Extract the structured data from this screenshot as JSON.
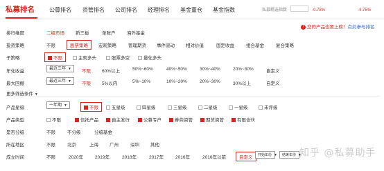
{
  "nav": {
    "brand": "私募排名",
    "tabs": [
      "公募排名",
      "资管排名",
      "公司排名",
      "经理排名",
      "基金重仓",
      "基金指数"
    ],
    "ticker_label": "私募精选指数",
    "ticker_values": [
      "-0.78%",
      "-4.75%"
    ]
  },
  "hint": {
    "dot": "!",
    "text": "您的产品也要上榜！",
    "link": "点此参与排名"
  },
  "rows": {
    "sort_dim": {
      "label": "排行维度",
      "options": [
        "二级市场",
        "新三板",
        "单账户",
        "海外基金"
      ]
    },
    "strategy": {
      "label": "投资策略",
      "options": [
        "不限",
        "股票策略",
        "宏观策略",
        "管理期货",
        "事件驱动",
        "相对价值",
        "固定收益",
        "组合基金",
        "复合策略"
      ]
    },
    "sub": {
      "label": "子策略",
      "options": [
        "不限",
        "主观多头",
        "股票多空",
        "量化多头"
      ]
    },
    "annual": {
      "label": "年化收益",
      "select": "最近三年",
      "options": [
        "不限",
        "60%以上",
        "50%~60%",
        "40%~50%",
        "30%~40%",
        "20%~30%",
        "自定义"
      ]
    },
    "drawdown": {
      "label": "最大回撤",
      "select": "最近三年",
      "options": [
        "不限",
        "5%以内",
        "5%~10%",
        "10%~20%",
        "20%~30%",
        "30%以上",
        "自定义"
      ]
    },
    "more": {
      "label": "更多筛选条件"
    },
    "star": {
      "label": "产品星级",
      "select": "一年期",
      "options": [
        "不限",
        "五星级",
        "四星级",
        "三星级",
        "二星级",
        "一星级",
        "未评级"
      ]
    },
    "type": {
      "label": "产品类型",
      "options": [
        "不限",
        "信托产品",
        "自主发行",
        "公募专户",
        "券商资管",
        "期货资管",
        "有限合伙"
      ]
    },
    "grade": {
      "label": "是否分级",
      "options": [
        "不限",
        "不分级",
        "分级基金"
      ]
    },
    "region": {
      "label": "所在地区",
      "options": [
        "不限",
        "北京",
        "上海",
        "广州",
        "深圳",
        "其他"
      ]
    },
    "established": {
      "label": "成立时间",
      "options": [
        "不限",
        "2020年",
        "2019年",
        "2018年",
        "2017年",
        "2016年",
        "2016年以前",
        "自定义"
      ],
      "start_placeholder": "开始年份",
      "end_placeholder": "结束年份"
    }
  },
  "watermark": "知乎 @私募助手"
}
